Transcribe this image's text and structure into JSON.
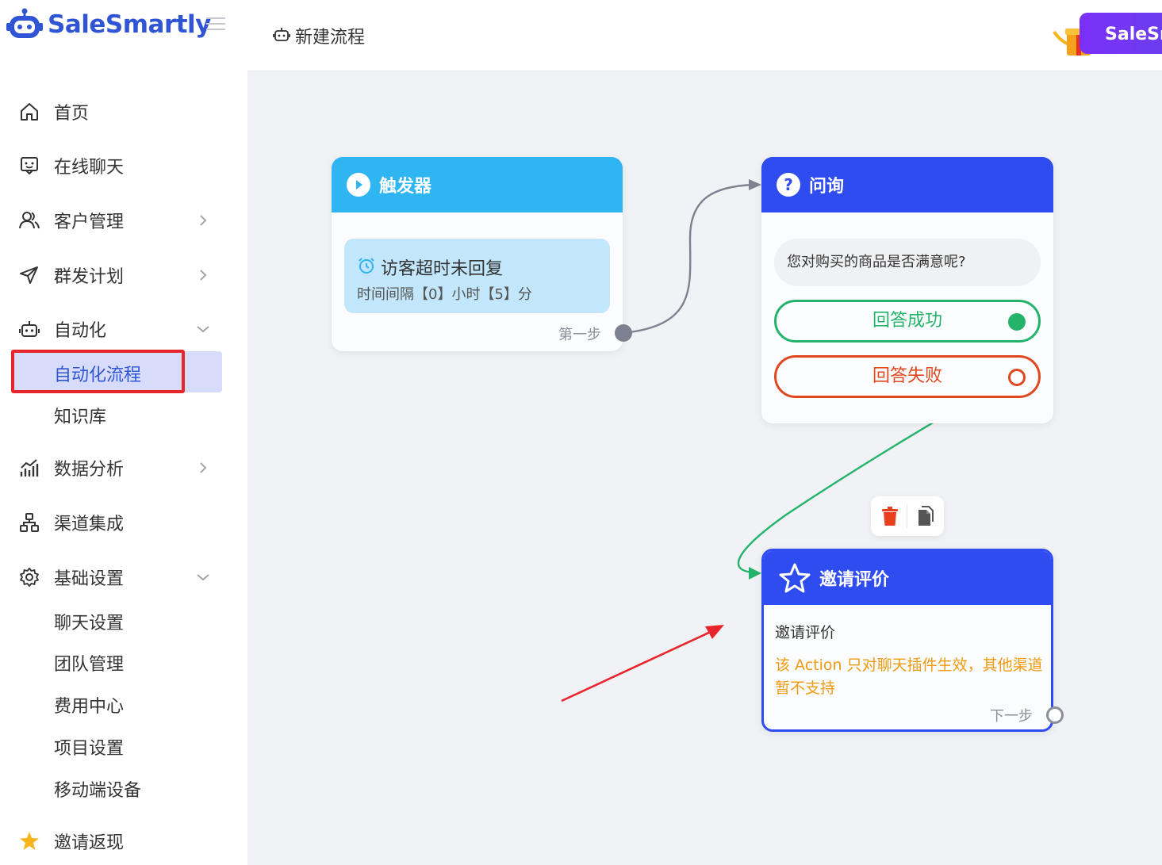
{
  "app": {
    "name": "SaleSmartly"
  },
  "header": {
    "title": "新建流程",
    "promo_text": "SaleSm"
  },
  "sidebar": {
    "items": [
      {
        "label": "首页",
        "icon": "home-icon"
      },
      {
        "label": "在线聊天",
        "icon": "chat-icon"
      },
      {
        "label": "客户管理",
        "icon": "users-icon"
      },
      {
        "label": "群发计划",
        "icon": "send-icon"
      },
      {
        "label": "自动化",
        "icon": "robot-icon"
      },
      {
        "label": "数据分析",
        "icon": "chart-icon"
      },
      {
        "label": "渠道集成",
        "icon": "integration-icon"
      },
      {
        "label": "基础设置",
        "icon": "gear-icon"
      },
      {
        "label": "邀请返现",
        "icon": "star-icon"
      }
    ],
    "automation_sub": [
      "自动化流程",
      "知识库"
    ],
    "settings_sub": [
      "聊天设置",
      "团队管理",
      "费用中心",
      "项目设置",
      "移动端设备"
    ]
  },
  "flow": {
    "trigger": {
      "title": "触发器",
      "event": "访客超时未回复",
      "detail": "时间间隔【0】小时【5】分",
      "step_label": "第一步"
    },
    "ask": {
      "title": "问询",
      "question": "您对购买的商品是否满意呢?",
      "success": "回答成功",
      "failure": "回答失败"
    },
    "invite": {
      "title": "邀请评价",
      "body_title": "邀请评价",
      "warning": "该 Action 只对聊天插件生效，其他渠道暂不支持",
      "next_label": "下一步"
    }
  },
  "colors": {
    "brand": "#2f55d4",
    "trigger": "#2eb5f2",
    "node": "#2f4cf0",
    "success": "#24b36b",
    "failure": "#e0481f",
    "warning": "#f09a10",
    "highlight": "#e8252b"
  }
}
